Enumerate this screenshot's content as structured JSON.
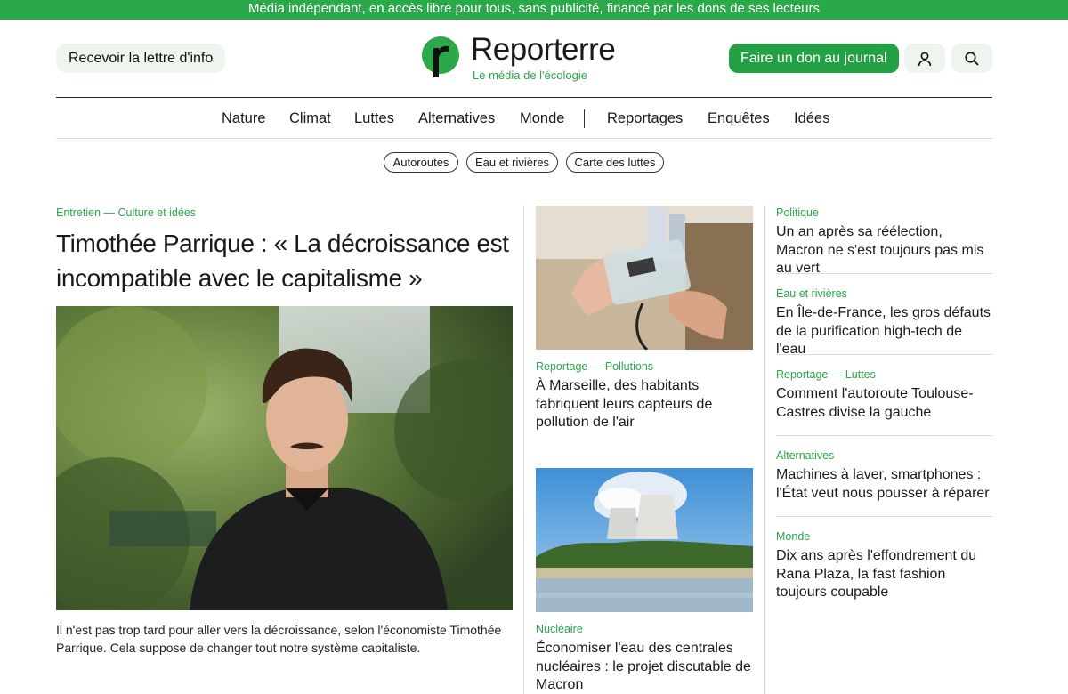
{
  "topbar": {
    "text": "Média indépendant, en accès libre pour tous, sans publicité, financé par les dons de ses lecteurs"
  },
  "header": {
    "newsletter_label": "Recevoir la lettre d'info",
    "logo_name": "Reporterre",
    "logo_tagline": "Le média de l'écologie",
    "donate_label": "Faire un don au journal",
    "user_icon": "user-icon",
    "search_icon": "search-icon"
  },
  "nav": {
    "items": [
      "Nature",
      "Climat",
      "Luttes",
      "Alternatives",
      "Monde",
      "Reportages",
      "Enquêtes",
      "Idées"
    ]
  },
  "tags": [
    "Autoroutes",
    "Eau et rivières",
    "Carte des luttes"
  ],
  "lead": {
    "kicker": "Entretien — Culture et idées",
    "title": "Timothée Parrique : « La décroissance est incompatible avec le capitalisme »",
    "description": "Il n'est pas trop tard pour aller vers la décroissance, selon l'économiste Timothée Parrique. Cela suppose de changer tout notre système capitaliste."
  },
  "middle": [
    {
      "kicker": "Reportage — Pollutions",
      "title": "À Marseille, des habitants fabriquent leurs capteurs de pollution de l'air"
    },
    {
      "kicker": "Nucléaire",
      "title": "Économiser l'eau des centrales nucléaires : le projet discutable de Macron"
    }
  ],
  "sidebar": [
    {
      "kicker": "Politique",
      "title": "Un an après sa réélection, Macron ne s'est toujours pas mis au vert"
    },
    {
      "kicker": "Eau et rivières",
      "title": "En Île-de-France, les gros défauts de la purification high-tech de l'eau"
    },
    {
      "kicker": "Reportage — Luttes",
      "title": "Comment l'autoroute Toulouse-Castres divise la gauche"
    },
    {
      "kicker": "Alternatives",
      "title": "Machines à laver, smartphones : l'État veut nous pousser à réparer"
    },
    {
      "kicker": "Monde",
      "title": "Dix ans après l'effondrement du Rana Plaza, la fast fashion toujours coupable"
    }
  ],
  "colors": {
    "brand_green": "#2aa84a",
    "text": "#1a1a1a"
  }
}
